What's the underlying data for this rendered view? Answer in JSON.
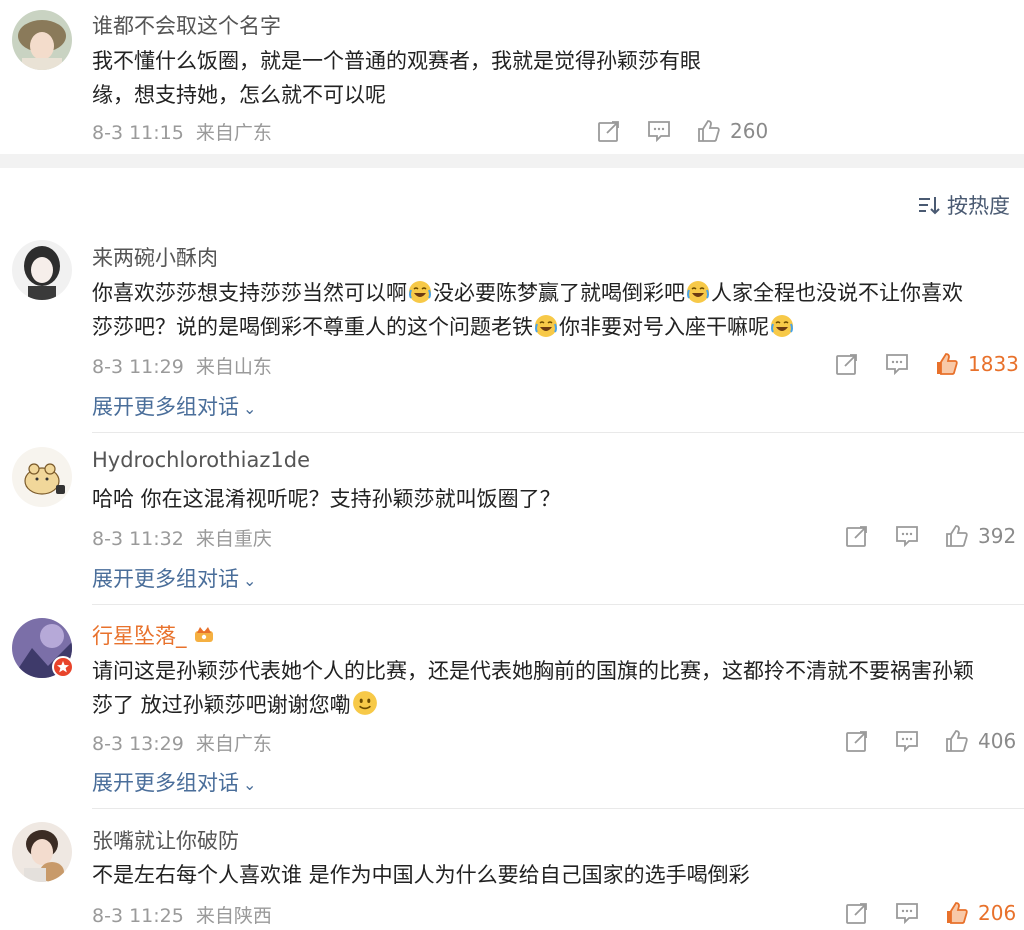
{
  "sort": {
    "label": "按热度"
  },
  "comments": [
    {
      "username": "谁都不会取这个名字",
      "lines": [
        "我不懂什么饭圈，就是一个普通的观赛者，我就是觉得孙颖莎有眼",
        "缘，想支持她，怎么就不可以呢"
      ],
      "time": "8-3 11:15",
      "location": "来自广东",
      "likes": "260",
      "liked": false
    },
    {
      "username": "来两碗小酥肉",
      "line1": {
        "a": "你喜欢莎莎想支持莎莎当然可以啊",
        "b": "没必要陈梦赢了就喝倒彩吧",
        "c": "人家全程也没说不让你喜欢"
      },
      "line2": {
        "a": "莎莎吧？说的是喝倒彩不尊重人的这个问题老铁",
        "b": "你非要对号入座干嘛呢"
      },
      "time": "8-3 11:29",
      "location": "来自山东",
      "likes": "1833",
      "liked": true,
      "expand": "展开更多组对话"
    },
    {
      "username": "Hydrochlorothiaz1de",
      "lines": [
        "哈哈 你在这混淆视听呢？支持孙颖莎就叫饭圈了？"
      ],
      "time": "8-3 11:32",
      "location": "来自重庆",
      "likes": "392",
      "liked": false,
      "expand": "展开更多组对话"
    },
    {
      "username": "行星坠落_",
      "lines": [
        "请问这是孙颖莎代表她个人的比赛，还是代表她胸前的国旗的比赛，这都拎不清就不要祸害孙颖",
        "莎了 放过孙颖莎吧谢谢您嘞"
      ],
      "time": "8-3 13:29",
      "location": "来自广东",
      "likes": "406",
      "liked": false,
      "expand": "展开更多组对话"
    },
    {
      "username": "张嘴就让你破防",
      "lines": [
        "不是左右每个人喜欢谁 是作为中国人为什么要给自己国家的选手喝倒彩"
      ],
      "time": "8-3 11:25",
      "location": "来自陕西",
      "likes": "206",
      "liked": true
    }
  ],
  "colors": {
    "link_blue": "#4a6e9a",
    "hot_orange": "#e8712b",
    "meta_gray": "#9a9a9a"
  },
  "icons": [
    "share-icon",
    "reply-icon",
    "thumb-up-icon",
    "sort-icon",
    "laugh-cry-emoji-icon",
    "smile-emoji-icon",
    "crown-badge-icon",
    "chevron-down-icon"
  ]
}
